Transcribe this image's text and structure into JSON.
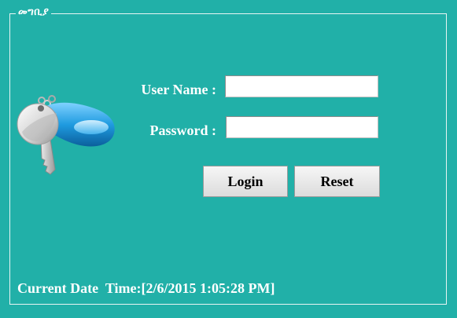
{
  "login_group": {
    "title": "መግቢያ"
  },
  "icons": {
    "login_graphic": "key-icon"
  },
  "colors": {
    "background": "#21b0a8",
    "text": "#ffffff",
    "key_tag": "#1f9be0"
  },
  "form": {
    "username_label": "User Name :",
    "username_value": "",
    "password_label": "Password :",
    "password_value": ""
  },
  "buttons": {
    "login_label": "Login",
    "reset_label": "Reset"
  },
  "status": {
    "current_date_label": "Current Date  Time:[2/6/2015 1:05:28 PM]"
  }
}
